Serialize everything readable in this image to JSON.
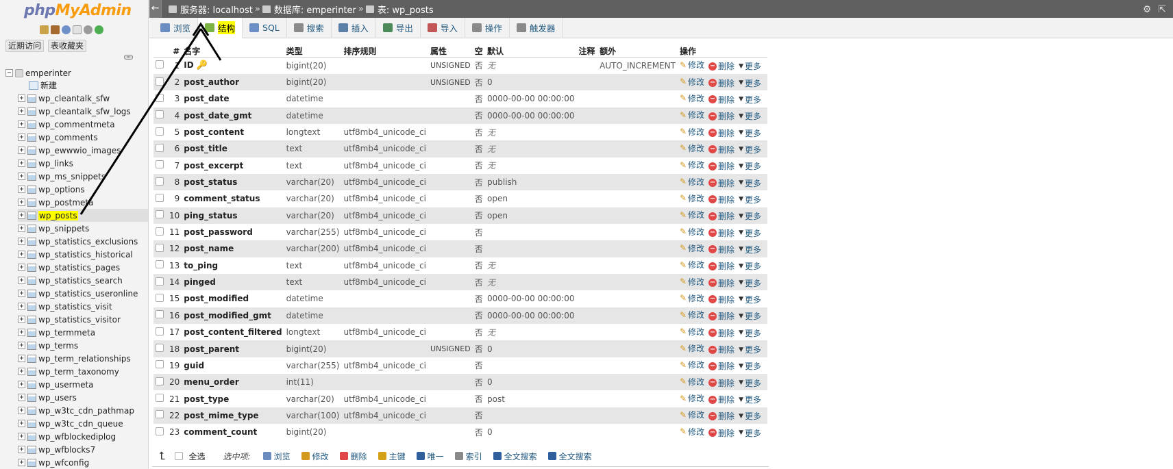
{
  "app": {
    "logo_php": "php",
    "logo_myadmin": "MyAdmin"
  },
  "sidebar": {
    "recent": "近期访问",
    "favorites": "表收藏夹",
    "db_name": "emperinter",
    "new_label": "新建",
    "tables": [
      "wp_cleantalk_sfw",
      "wp_cleantalk_sfw_logs",
      "wp_commentmeta",
      "wp_comments",
      "wp_ewwwio_images",
      "wp_links",
      "wp_ms_snippets",
      "wp_options",
      "wp_postmeta",
      "wp_posts",
      "wp_snippets",
      "wp_statistics_exclusions",
      "wp_statistics_historical",
      "wp_statistics_pages",
      "wp_statistics_search",
      "wp_statistics_useronline",
      "wp_statistics_visit",
      "wp_statistics_visitor",
      "wp_termmeta",
      "wp_terms",
      "wp_term_relationships",
      "wp_term_taxonomy",
      "wp_usermeta",
      "wp_users",
      "wp_w3tc_cdn_pathmap",
      "wp_w3tc_cdn_queue",
      "wp_wfblockediplog",
      "wp_wfblocks7",
      "wp_wfconfig"
    ],
    "selected_table": "wp_posts",
    "postmeta_visible": "wp_postmet"
  },
  "breadcrumb": {
    "server_label": "服务器: localhost",
    "db_label": "数据库: emperinter",
    "table_label": "表: wp_posts",
    "sep": "»"
  },
  "tabs": [
    {
      "label": "浏览",
      "icon": "browse-icon",
      "color": "#6b8cc0"
    },
    {
      "label": "结构",
      "icon": "structure-icon",
      "color": "#7cb342"
    },
    {
      "label": "SQL",
      "icon": "sql-icon",
      "color": "#6d8fc7"
    },
    {
      "label": "搜索",
      "icon": "search-icon",
      "color": "#8a8a8a"
    },
    {
      "label": "插入",
      "icon": "insert-icon",
      "color": "#5c7fa8"
    },
    {
      "label": "导出",
      "icon": "export-icon",
      "color": "#4c8a5a"
    },
    {
      "label": "导入",
      "icon": "import-icon",
      "color": "#c25555"
    },
    {
      "label": "操作",
      "icon": "wrench-icon",
      "color": "#8a8a8a"
    },
    {
      "label": "触发器",
      "icon": "trigger-icon",
      "color": "#8a8a8a"
    }
  ],
  "table": {
    "headers": {
      "num": "#",
      "name": "名字",
      "type": "类型",
      "collation": "排序规则",
      "attr": "属性",
      "null": "空",
      "default": "默认",
      "comment": "注释",
      "extra": "额外",
      "action": "操作"
    },
    "action_labels": {
      "edit": "修改",
      "delete": "删除",
      "more": "更多"
    },
    "rows": [
      {
        "num": "1",
        "name": "ID",
        "type": "bigint(20)",
        "collation": "",
        "attr": "UNSIGNED",
        "null": "否",
        "default": "无",
        "extra": "AUTO_INCREMENT",
        "key": true
      },
      {
        "num": "2",
        "name": "post_author",
        "type": "bigint(20)",
        "collation": "",
        "attr": "UNSIGNED",
        "null": "否",
        "default": "0",
        "extra": ""
      },
      {
        "num": "3",
        "name": "post_date",
        "type": "datetime",
        "collation": "",
        "attr": "",
        "null": "否",
        "default": "0000-00-00 00:00:00",
        "extra": ""
      },
      {
        "num": "4",
        "name": "post_date_gmt",
        "type": "datetime",
        "collation": "",
        "attr": "",
        "null": "否",
        "default": "0000-00-00 00:00:00",
        "extra": ""
      },
      {
        "num": "5",
        "name": "post_content",
        "type": "longtext",
        "collation": "utf8mb4_unicode_ci",
        "attr": "",
        "null": "否",
        "default": "无",
        "extra": ""
      },
      {
        "num": "6",
        "name": "post_title",
        "type": "text",
        "collation": "utf8mb4_unicode_ci",
        "attr": "",
        "null": "否",
        "default": "无",
        "extra": ""
      },
      {
        "num": "7",
        "name": "post_excerpt",
        "type": "text",
        "collation": "utf8mb4_unicode_ci",
        "attr": "",
        "null": "否",
        "default": "无",
        "extra": ""
      },
      {
        "num": "8",
        "name": "post_status",
        "type": "varchar(20)",
        "collation": "utf8mb4_unicode_ci",
        "attr": "",
        "null": "否",
        "default": "publish",
        "extra": ""
      },
      {
        "num": "9",
        "name": "comment_status",
        "type": "varchar(20)",
        "collation": "utf8mb4_unicode_ci",
        "attr": "",
        "null": "否",
        "default": "open",
        "extra": ""
      },
      {
        "num": "10",
        "name": "ping_status",
        "type": "varchar(20)",
        "collation": "utf8mb4_unicode_ci",
        "attr": "",
        "null": "否",
        "default": "open",
        "extra": ""
      },
      {
        "num": "11",
        "name": "post_password",
        "type": "varchar(255)",
        "collation": "utf8mb4_unicode_ci",
        "attr": "",
        "null": "否",
        "default": "",
        "extra": ""
      },
      {
        "num": "12",
        "name": "post_name",
        "type": "varchar(200)",
        "collation": "utf8mb4_unicode_ci",
        "attr": "",
        "null": "否",
        "default": "",
        "extra": ""
      },
      {
        "num": "13",
        "name": "to_ping",
        "type": "text",
        "collation": "utf8mb4_unicode_ci",
        "attr": "",
        "null": "否",
        "default": "无",
        "extra": ""
      },
      {
        "num": "14",
        "name": "pinged",
        "type": "text",
        "collation": "utf8mb4_unicode_ci",
        "attr": "",
        "null": "否",
        "default": "无",
        "extra": ""
      },
      {
        "num": "15",
        "name": "post_modified",
        "type": "datetime",
        "collation": "",
        "attr": "",
        "null": "否",
        "default": "0000-00-00 00:00:00",
        "extra": ""
      },
      {
        "num": "16",
        "name": "post_modified_gmt",
        "type": "datetime",
        "collation": "",
        "attr": "",
        "null": "否",
        "default": "0000-00-00 00:00:00",
        "extra": ""
      },
      {
        "num": "17",
        "name": "post_content_filtered",
        "type": "longtext",
        "collation": "utf8mb4_unicode_ci",
        "attr": "",
        "null": "否",
        "default": "无",
        "extra": ""
      },
      {
        "num": "18",
        "name": "post_parent",
        "type": "bigint(20)",
        "collation": "",
        "attr": "UNSIGNED",
        "null": "否",
        "default": "0",
        "extra": ""
      },
      {
        "num": "19",
        "name": "guid",
        "type": "varchar(255)",
        "collation": "utf8mb4_unicode_ci",
        "attr": "",
        "null": "否",
        "default": "",
        "extra": ""
      },
      {
        "num": "20",
        "name": "menu_order",
        "type": "int(11)",
        "collation": "",
        "attr": "",
        "null": "否",
        "default": "0",
        "extra": ""
      },
      {
        "num": "21",
        "name": "post_type",
        "type": "varchar(20)",
        "collation": "utf8mb4_unicode_ci",
        "attr": "",
        "null": "否",
        "default": "post",
        "extra": ""
      },
      {
        "num": "22",
        "name": "post_mime_type",
        "type": "varchar(100)",
        "collation": "utf8mb4_unicode_ci",
        "attr": "",
        "null": "否",
        "default": "",
        "extra": ""
      },
      {
        "num": "23",
        "name": "comment_count",
        "type": "bigint(20)",
        "collation": "",
        "attr": "",
        "null": "否",
        "default": "0",
        "extra": ""
      }
    ]
  },
  "bottom": {
    "select_all": "全选",
    "selected": "选中项:",
    "actions": [
      {
        "label": "浏览",
        "icon": "browse-icon",
        "color": "#6b8cc0"
      },
      {
        "label": "修改",
        "icon": "pencil-icon",
        "color": "#d49a1f"
      },
      {
        "label": "删除",
        "icon": "delete-icon",
        "color": "#e04848"
      },
      {
        "label": "主键",
        "icon": "primary-key-icon",
        "color": "#d4a017"
      },
      {
        "label": "唯一",
        "icon": "unique-icon",
        "color": "#2f5f9c"
      },
      {
        "label": "索引",
        "icon": "index-icon",
        "color": "#8a8a8a"
      },
      {
        "label": "全文搜索",
        "icon": "fulltext-icon",
        "color": "#2f5f9c"
      },
      {
        "label": "全文搜索",
        "icon": "fulltext-icon",
        "color": "#2f5f9c"
      }
    ]
  }
}
